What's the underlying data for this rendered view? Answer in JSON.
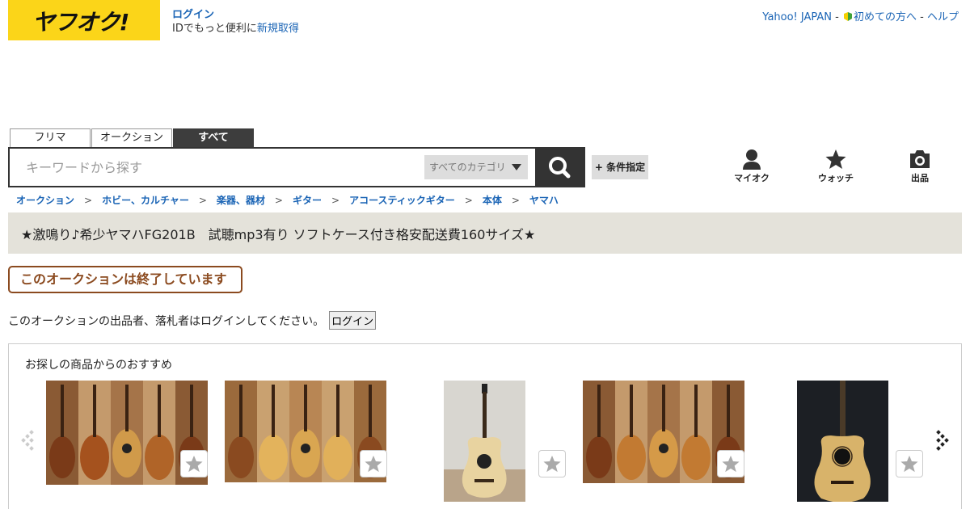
{
  "header": {
    "logo_text": "ヤフオク!",
    "login_link": "ログイン",
    "login_prompt": "IDでもっと便利に",
    "signup_link": "新規取得",
    "yahoo_link": "Yahoo! JAPAN",
    "first_time_link": "初めての方へ",
    "help_link": "ヘルプ"
  },
  "search": {
    "tabs": [
      "フリマ",
      "オークション",
      "すべて"
    ],
    "active_tab": "すべて",
    "placeholder": "キーワードから探す",
    "category": "すべてのカテゴリ",
    "conditions_label": "+ 条件指定"
  },
  "nav_icons": {
    "myauc": "マイオク",
    "watch": "ウォッチ",
    "sell": "出品"
  },
  "breadcrumb": [
    "オークション",
    "ホビー、カルチャー",
    "楽器、器材",
    "ギター",
    "アコースティックギター",
    "本体",
    "ヤマハ"
  ],
  "item": {
    "title": "★激鳴り♪希少ヤマハFG201B　試聴mp3有り ソフトケース付き格安配送費160サイズ★",
    "ended_label": "このオークションは終了しています",
    "notice": "このオークションの出品者、落札者はログインしてください。",
    "login_button": "ログイン"
  },
  "recommendations": {
    "heading": "お探しの商品からのおすすめ",
    "items": [
      {
        "image": "guitar-multi-view-photo"
      },
      {
        "image": "guitar-multi-view-photo"
      },
      {
        "image": "guitar-standing-photo"
      },
      {
        "image": "guitar-multi-view-photo"
      },
      {
        "image": "guitar-closeup-photo"
      }
    ]
  },
  "colors": {
    "brand_yellow": "#fbd519",
    "link_blue": "#1a64b5",
    "ended_brown": "#8b4a1f",
    "title_bg": "#e4e2da"
  }
}
